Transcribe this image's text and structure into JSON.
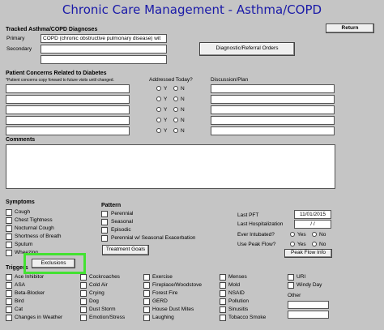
{
  "title": "Chronic Care Management - Asthma/COPD",
  "return_button": "Return",
  "diagnoses": {
    "heading": "Tracked Asthma/COPD Diagnoses",
    "primary_label": "Primary",
    "primary_value": "COPD (chronic obstructive pulmonary disease) wit",
    "secondary_label": "Secondary",
    "secondary_value": "",
    "referral_button": "Diagnostic/Referral Orders"
  },
  "concerns": {
    "heading": "Patient Concerns Related to Diabetes",
    "note": "*Patient concerns copy forward to future visits until changed.",
    "addressed_label": "Addressed Today?",
    "discussion_label": "Discussion/Plan",
    "yes": "Y",
    "no": "N"
  },
  "comments": {
    "heading": "Comments"
  },
  "symptoms": {
    "heading": "Symptoms",
    "items": [
      "Cough",
      "Chest Tightness",
      "Nocturnal Cough",
      "Shortness of Breath",
      "Sputum",
      "Wheezing"
    ]
  },
  "pattern": {
    "heading": "Pattern",
    "items": [
      "Perennial",
      "Seasonal",
      "Episodic",
      "Perennial w/ Seasonal Exacerbation"
    ],
    "treatment_goals_button": "Treatment Goals"
  },
  "pft": {
    "last_pft_label": "Last PFT",
    "last_pft_value": "11/01/2015",
    "last_hosp_label": "Last Hospitalization",
    "last_hosp_value": "/ /",
    "intubated_label": "Ever Intubated?",
    "peak_flow_label": "Use Peak Flow?",
    "yes": "Yes",
    "no": "No",
    "peak_flow_button": "Peak Flow Info"
  },
  "triggers": {
    "heading": "Triggers",
    "exclusions_button": "Exclusions",
    "col1": [
      "Ace Inhibitor",
      "ASA",
      "Beta-Blocker",
      "Bird",
      "Cat",
      "Changes in Weather"
    ],
    "col2": [
      "Cockroaches",
      "Cold Air",
      "Crying",
      "Dog",
      "Dust Storm",
      "Emotion/Stress"
    ],
    "col3": [
      "Exercise",
      "Fireplace/Woodstove",
      "Forest Fire",
      "GERD",
      "House Dust Mites",
      "Laughing"
    ],
    "col4": [
      "Menses",
      "Mold",
      "NSAID",
      "Pollution",
      "Sinusitis",
      "Tobacco Smoke"
    ],
    "col5": [
      "URI",
      "Windy Day"
    ],
    "other_label": "Other"
  },
  "highlight_color": "#43e232",
  "title_color": "#1a1aa8"
}
